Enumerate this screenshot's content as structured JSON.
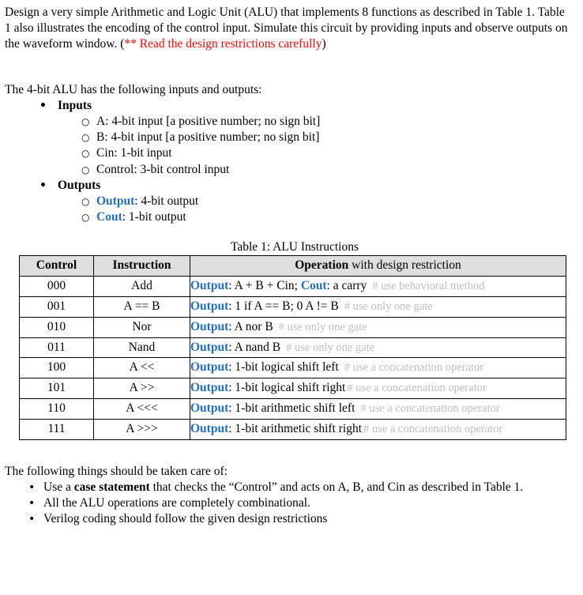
{
  "intro": {
    "part1": "Design a very simple Arithmetic and Logic Unit (ALU) that implements 8 functions as described in Table 1.  Table 1 also illustrates the encoding of the control input. Simulate this circuit by providing inputs and observe outputs on the waveform window. (",
    "red_note": "** Read the design restrictions carefully",
    "part2": ")"
  },
  "io_section": {
    "lead": "The 4-bit ALU has the following inputs and outputs:",
    "groups": [
      {
        "label": "Inputs",
        "items": [
          {
            "text": "A: 4-bit input [a positive number; no sign bit]"
          },
          {
            "text": "B: 4-bit input [a positive number; no sign bit]"
          },
          {
            "text": "Cin: 1-bit input"
          },
          {
            "text": "Control: 3-bit control input"
          }
        ]
      },
      {
        "label": "Outputs",
        "items": [
          {
            "name": "Output",
            "text": ": 4-bit output"
          },
          {
            "name": "Cout",
            "text": ": 1-bit output"
          }
        ]
      }
    ]
  },
  "table": {
    "caption": "Table 1: ALU Instructions",
    "headers": {
      "control": "Control",
      "instruction": "Instruction",
      "operation_bold": "Operation",
      "operation_rest": " with design restriction"
    },
    "rows": [
      {
        "control": "000",
        "instruction": "Add",
        "op_label1": "Output",
        "op_text1": ": A + B + Cin; ",
        "op_label2": "Cout",
        "op_text2": ": a carry",
        "comment": "# use behavioral method"
      },
      {
        "control": "001",
        "instruction": "A == B",
        "op_label1": "Output",
        "op_text1": ": 1 if A == B; 0 A != B",
        "op_label2": "",
        "op_text2": "",
        "comment": "# use only one gate"
      },
      {
        "control": "010",
        "instruction": "Nor",
        "op_label1": "Output",
        "op_text1": ": A  nor  B",
        "op_label2": "",
        "op_text2": "",
        "comment": "# use only one gate"
      },
      {
        "control": "011",
        "instruction": "Nand",
        "op_label1": "Output",
        "op_text1": ": A  nand B",
        "op_label2": "",
        "op_text2": "",
        "comment": "# use only one gate"
      },
      {
        "control": "100",
        "instruction": "A  <<",
        "op_label1": "Output",
        "op_text1": ": 1-bit logical shift left",
        "op_label2": "",
        "op_text2": "",
        "comment": "# use a concatenation operator"
      },
      {
        "control": "101",
        "instruction": "A  >>",
        "op_label1": "Output",
        "op_text1": ": 1-bit logical shift right",
        "op_label2": "",
        "op_text2": "",
        "comment": "# use a concatenation operator"
      },
      {
        "control": "110",
        "instruction": "A <<<",
        "op_label1": "Output",
        "op_text1": ": 1-bit arithmetic shift left",
        "op_label2": "",
        "op_text2": "",
        "comment": "# use a concatenation operator"
      },
      {
        "control": "111",
        "instruction": "A >>>",
        "op_label1": "Output",
        "op_text1": ": 1-bit arithmetic shift right",
        "op_label2": "",
        "op_text2": "",
        "comment": "# use a concatenation operator"
      }
    ]
  },
  "closing": {
    "lead": "The following things should be taken care of:",
    "items": [
      {
        "pre": "Use a ",
        "bold": "case statement",
        "post": " that checks the “Control” and acts on A, B, and Cin as described in Table 1."
      },
      {
        "pre": "All the ALU operations are completely combinational.",
        "bold": "",
        "post": ""
      },
      {
        "pre": "Verilog coding should follow the given design restrictions",
        "bold": "",
        "post": ""
      }
    ]
  },
  "glyphs": {
    "bullet_filled": "•",
    "bullet_hollow": "○"
  },
  "colors": {
    "red": "#ff0000",
    "blue": "#1f6fc4",
    "comment_gray": "#bfbfbf",
    "header_bg": "#dedede"
  }
}
